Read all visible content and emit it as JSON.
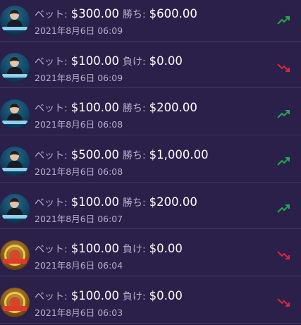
{
  "colors": {
    "background": "#2a2049",
    "divider": "#3f3768",
    "win": "#1fae4b",
    "loss": "#e0243a",
    "muted": "#b4b0ca"
  },
  "rows": [
    {
      "game_icon": "blackjack",
      "bet_label": "ベット:",
      "bet": "$300.00",
      "result_label": "勝ち:",
      "result": "$600.00",
      "time": "2021年8月6日 06:09",
      "trend": "up"
    },
    {
      "game_icon": "blackjack",
      "bet_label": "ベット:",
      "bet": "$100.00",
      "result_label": "負け:",
      "result": "$0.00",
      "time": "2021年8月6日 06:09",
      "trend": "down"
    },
    {
      "game_icon": "blackjack",
      "bet_label": "ベット:",
      "bet": "$100.00",
      "result_label": "勝ち:",
      "result": "$200.00",
      "time": "2021年8月6日 06:08",
      "trend": "up"
    },
    {
      "game_icon": "blackjack",
      "bet_label": "ベット:",
      "bet": "$500.00",
      "result_label": "勝ち:",
      "result": "$1,000.00",
      "time": "2021年8月6日 06:08",
      "trend": "up"
    },
    {
      "game_icon": "blackjack",
      "bet_label": "ベット:",
      "bet": "$100.00",
      "result_label": "勝ち:",
      "result": "$200.00",
      "time": "2021年8月6日 06:07",
      "trend": "up"
    },
    {
      "game_icon": "crazy-time",
      "bet_label": "ベット:",
      "bet": "$100.00",
      "result_label": "負け:",
      "result": "$0.00",
      "time": "2021年8月6日 06:04",
      "trend": "down"
    },
    {
      "game_icon": "crazy-time",
      "bet_label": "ベット:",
      "bet": "$100.00",
      "result_label": "負け:",
      "result": "$0.00",
      "time": "2021年8月6日 06:03",
      "trend": "down"
    }
  ]
}
